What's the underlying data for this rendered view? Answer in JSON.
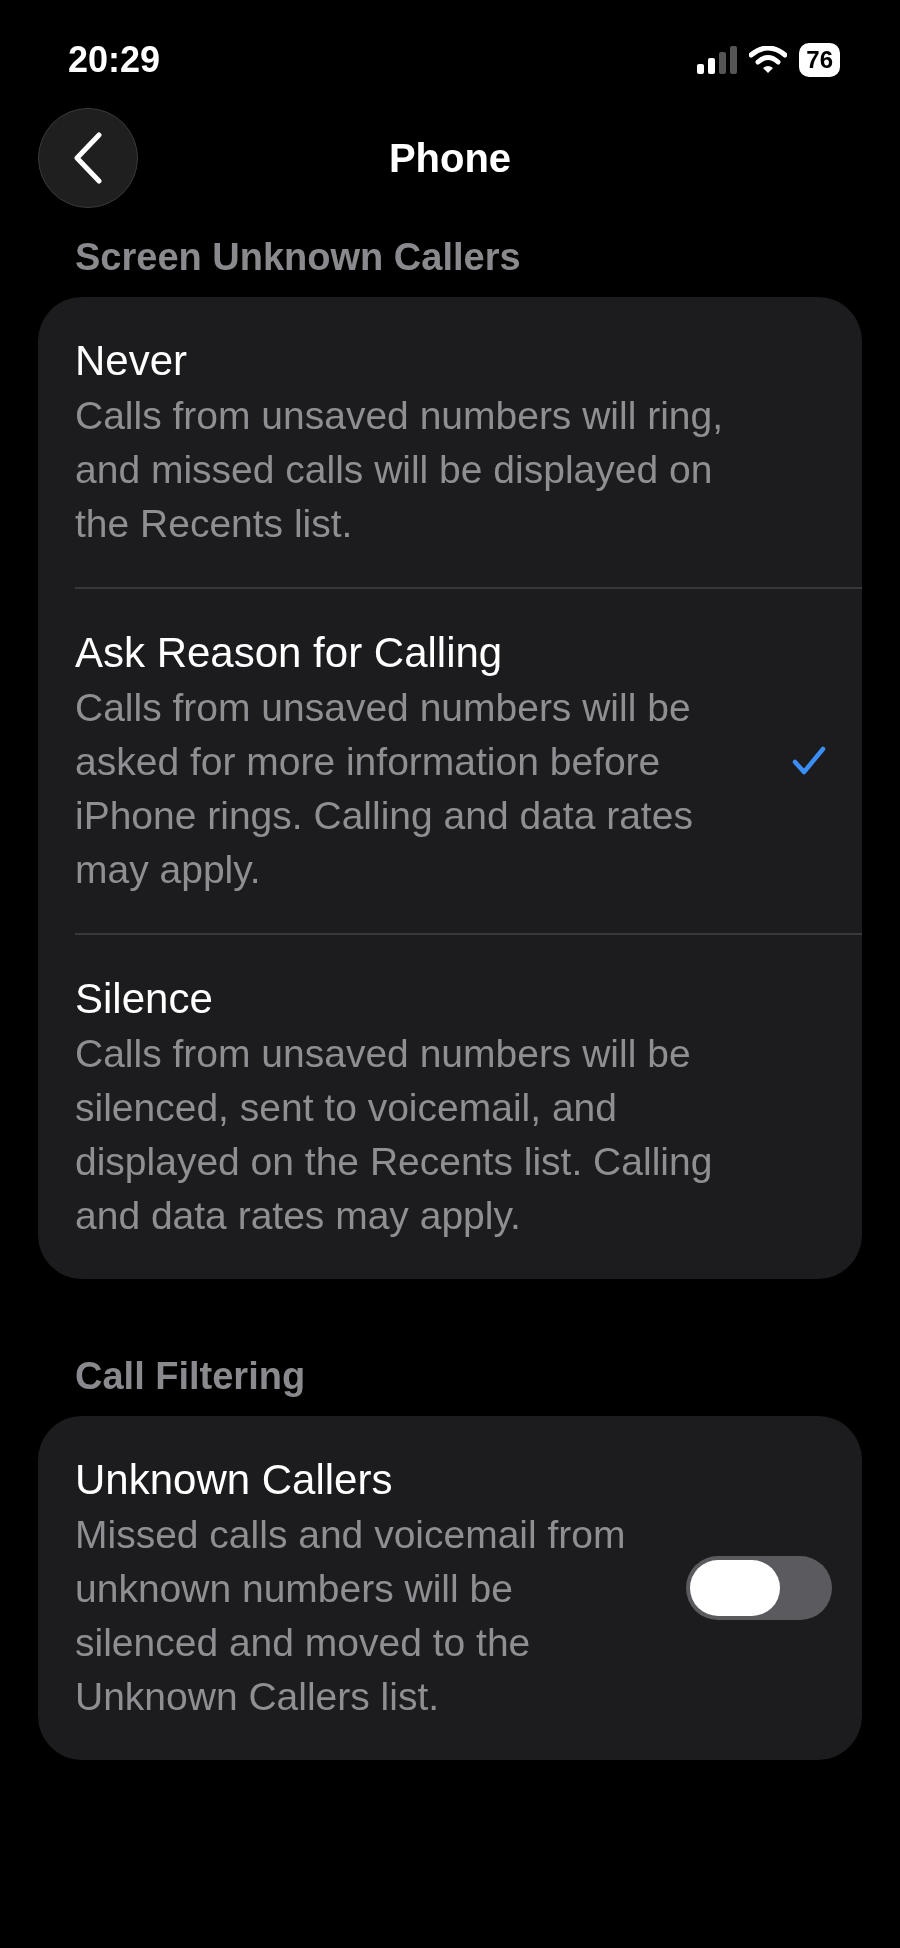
{
  "status_bar": {
    "time": "20:29",
    "battery": "76"
  },
  "nav": {
    "title": "Phone"
  },
  "sections": [
    {
      "header": "Screen Unknown Callers",
      "rows": [
        {
          "kind": "option",
          "title": "Never",
          "description": "Calls from unsaved numbers will ring, and missed calls will be displayed on the Recents list.",
          "selected": false
        },
        {
          "kind": "option",
          "title": "Ask Reason for Calling",
          "description": "Calls from unsaved numbers will be asked for more information before iPhone rings. Calling and data rates may apply.",
          "selected": true
        },
        {
          "kind": "option",
          "title": "Silence",
          "description": "Calls from unsaved numbers will be silenced, sent to voicemail, and displayed on the Recents list. Calling and data rates may apply.",
          "selected": false
        }
      ]
    },
    {
      "header": "Call Filtering",
      "rows": [
        {
          "kind": "toggle",
          "title": "Unknown Callers",
          "description": "Missed calls and voicemail from unknown numbers will be silenced and moved to the Unknown Callers list.",
          "on": false
        }
      ]
    }
  ]
}
